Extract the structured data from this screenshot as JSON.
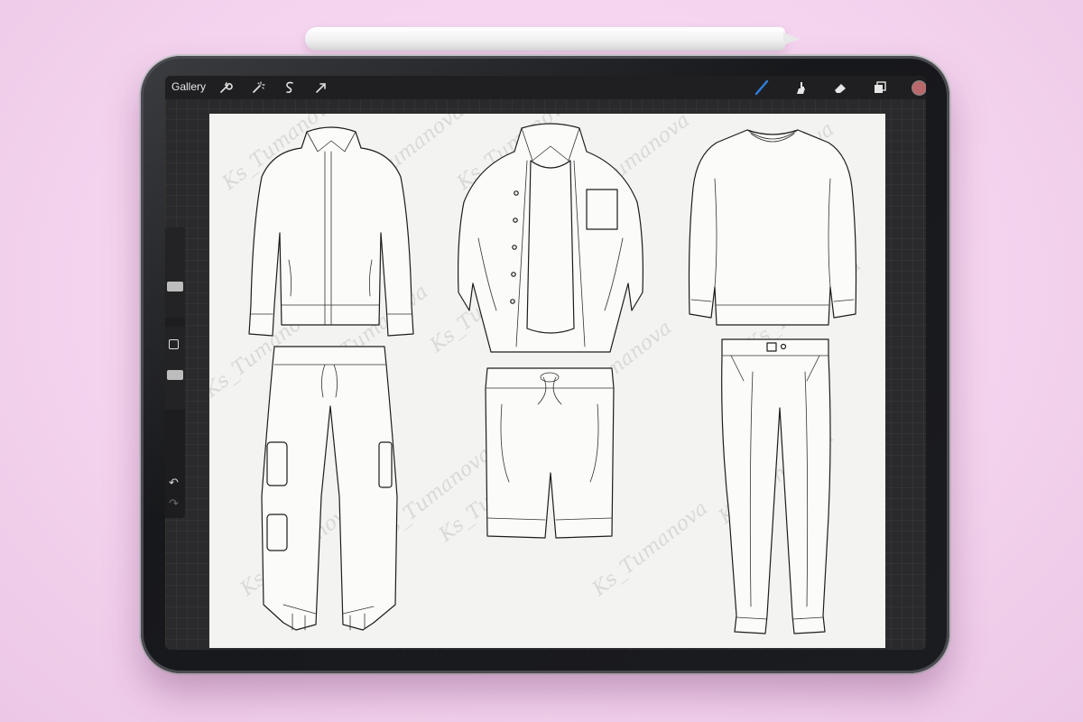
{
  "toolbar": {
    "gallery_label": "Gallery",
    "left_icons": [
      "wrench-icon",
      "magic-wand-icon",
      "selection-icon",
      "transform-arrow-icon"
    ],
    "right_icons": [
      "brush-icon",
      "smudge-icon",
      "eraser-icon",
      "layers-icon",
      "color-swatch"
    ],
    "active_tool_color": "#2f7fe0",
    "color_swatch": "#b9686b"
  },
  "sidebar": {
    "undo_icon": "↶",
    "redo_icon": "↷"
  },
  "canvas": {
    "watermark_text": "Ks_Tumanova",
    "garments": [
      "bomber-jacket",
      "cargo-joggers",
      "open-shirt-over-tee",
      "drawstring-shorts",
      "sweatshirt",
      "chino-trousers"
    ]
  }
}
